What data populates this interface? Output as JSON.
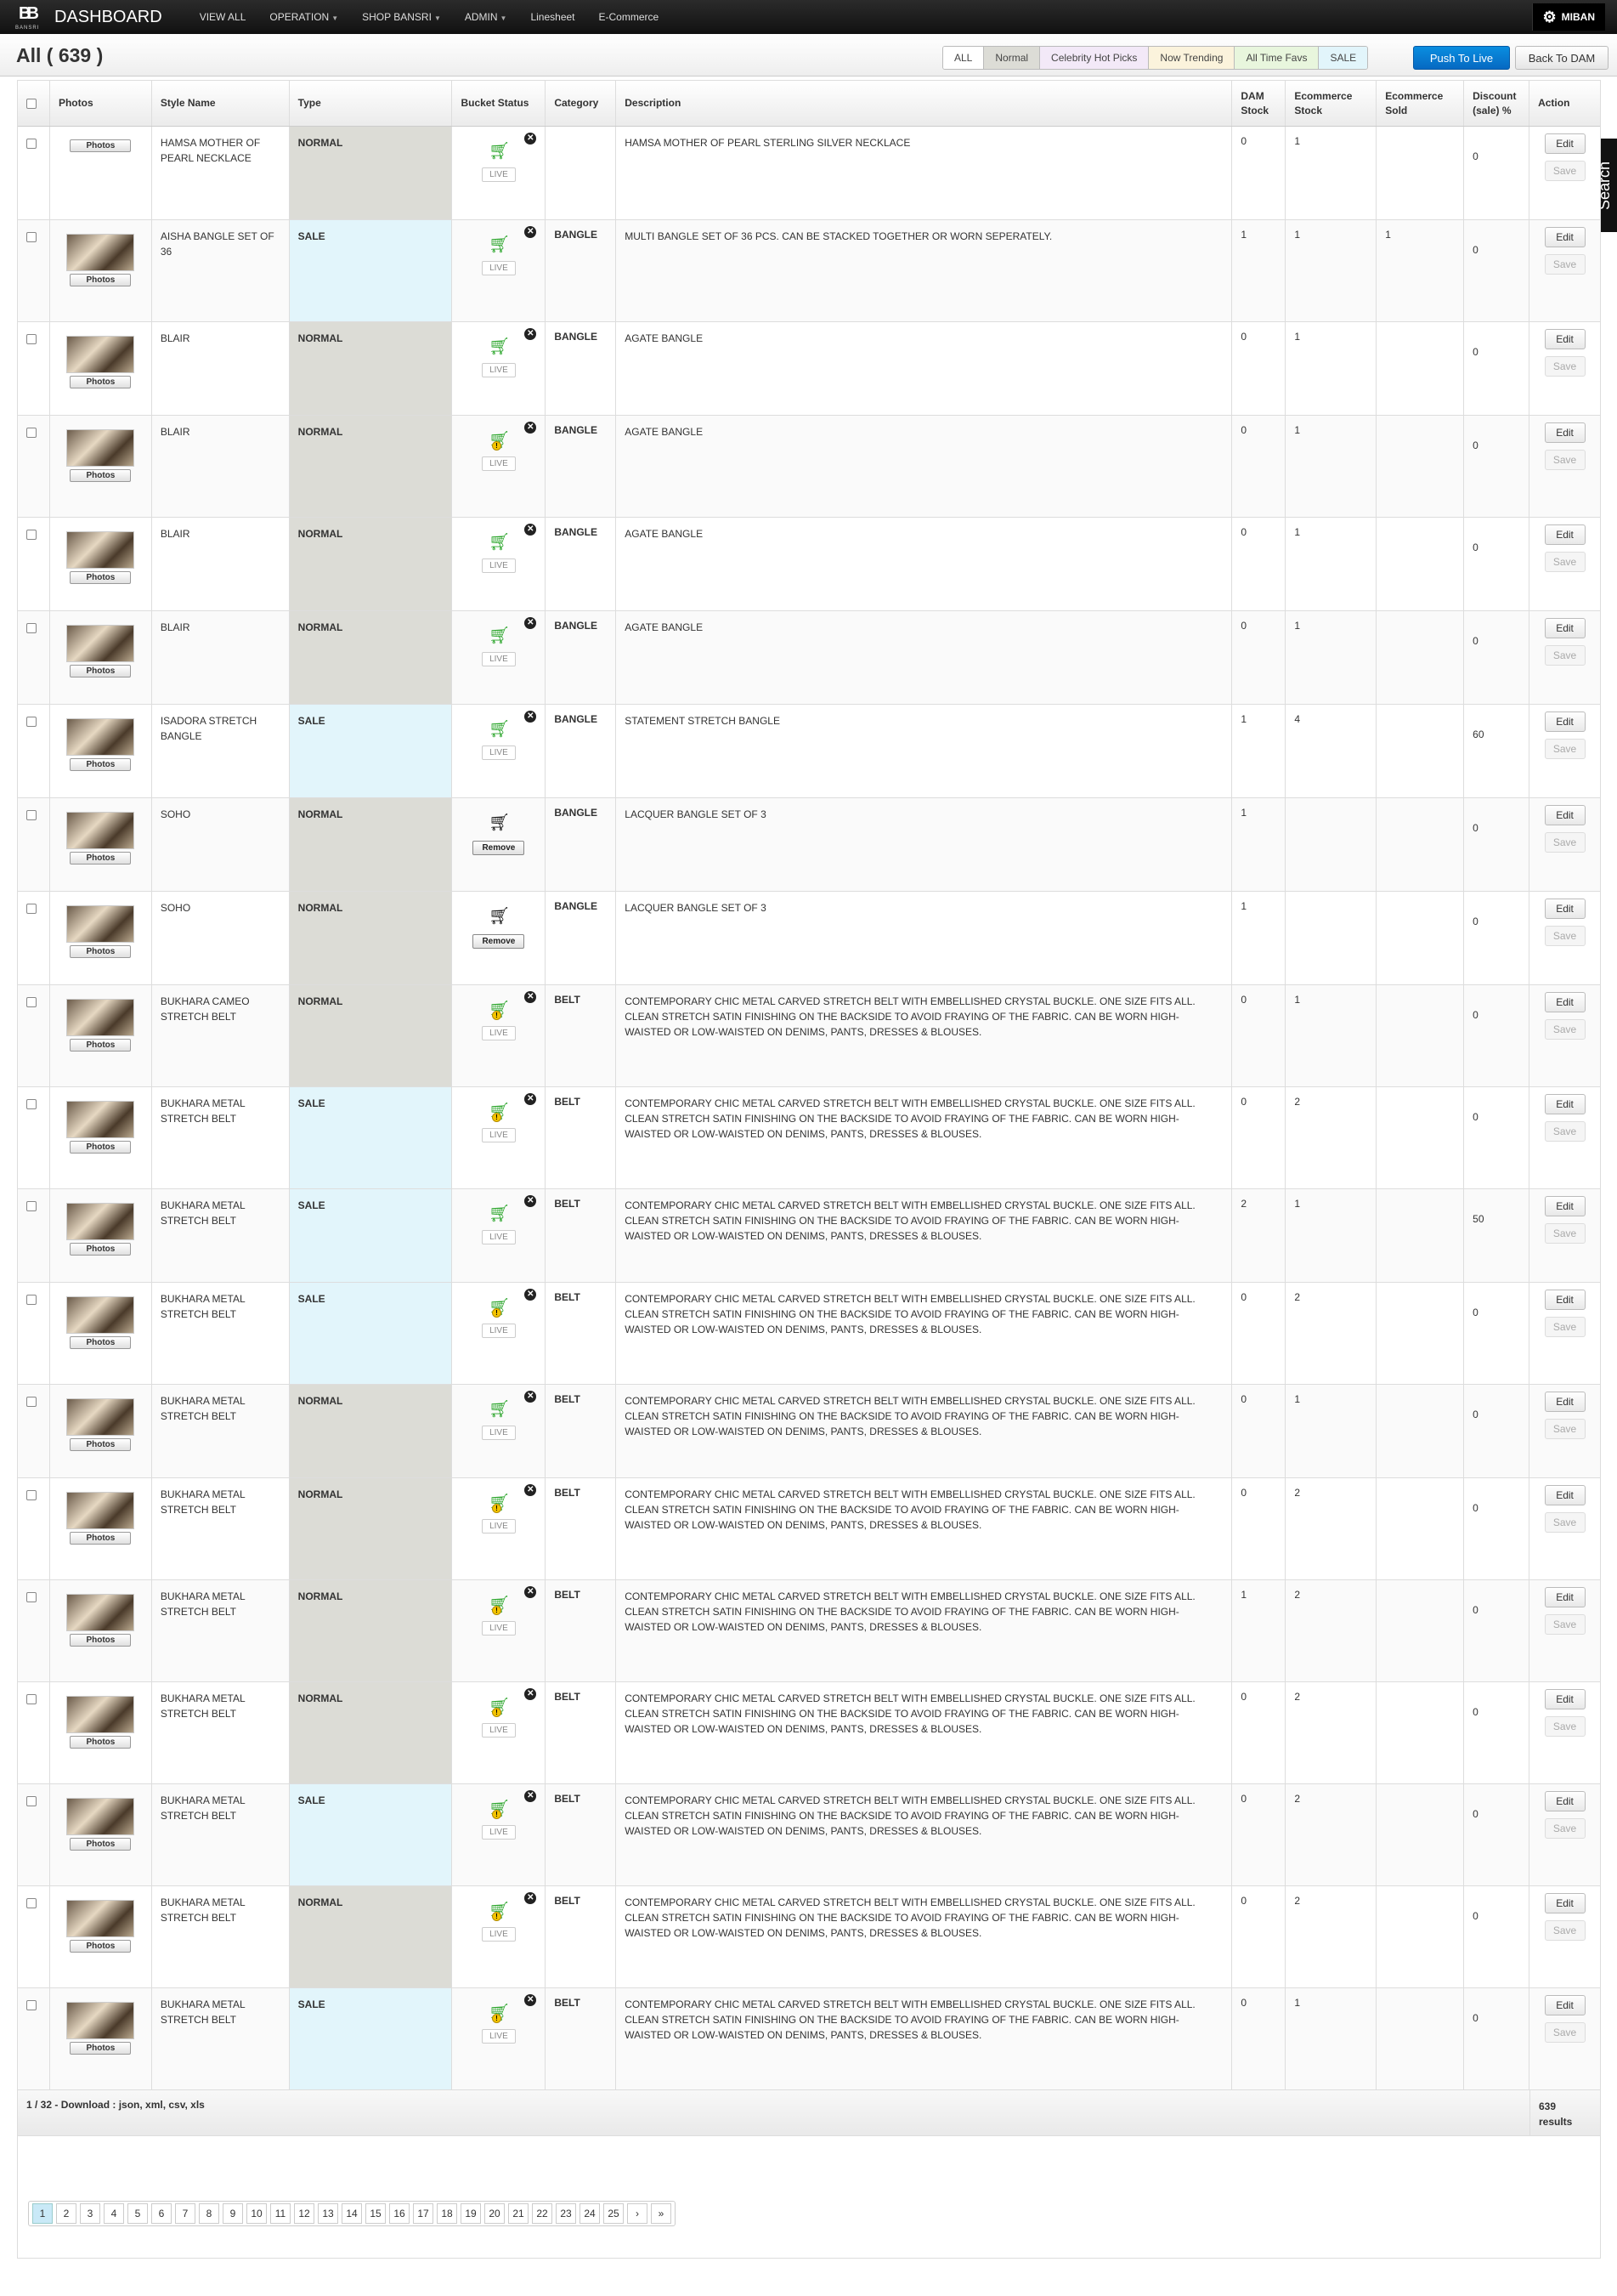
{
  "topbar": {
    "brand": "DASHBOARD",
    "logo_letters": "BB",
    "logo_sub": "BANSRI",
    "nav": [
      {
        "label": "VIEW ALL",
        "caret": false
      },
      {
        "label": "OPERATION",
        "caret": true
      },
      {
        "label": "SHOP BANSRI",
        "caret": true
      },
      {
        "label": "ADMIN",
        "caret": true
      },
      {
        "label": "Linesheet",
        "caret": false
      },
      {
        "label": "E-Commerce",
        "caret": false
      }
    ],
    "user": "MIBAN"
  },
  "page_title": "All ( 639 )",
  "filters": [
    {
      "label": "ALL",
      "color": "#ffffff"
    },
    {
      "label": "Normal",
      "color": "#dcdcd6"
    },
    {
      "label": "Celebrity Hot Picks",
      "color": "#f3e9f8"
    },
    {
      "label": "Now Trending",
      "color": "#fbf3dc"
    },
    {
      "label": "All Time Favs",
      "color": "#e8f6dd"
    },
    {
      "label": "SALE",
      "color": "#e2f5fb"
    }
  ],
  "buttons": {
    "push": "Push To Live",
    "back": "Back To DAM",
    "search": "Search"
  },
  "columns": [
    "",
    "Photos",
    "Style Name",
    "Type",
    "Bucket Status",
    "Category",
    "Description",
    "DAM Stock",
    "Ecommerce Stock",
    "Ecommerce Sold",
    "Discount (sale) %",
    "Action"
  ],
  "labels": {
    "photos": "Photos",
    "live": "LIVE",
    "remove": "Remove",
    "edit": "Edit",
    "save": "Save"
  },
  "rows": [
    {
      "style": "HAMSA MOTHER OF PEARL NECKLACE",
      "type": "NORMAL",
      "bucket": "live",
      "category": "",
      "desc": "HAMSA MOTHER OF PEARL STERLING SILVER NECKLACE",
      "dam": "0",
      "ecom": "1",
      "sold": "",
      "disc": "0",
      "thumb": false,
      "h": 110
    },
    {
      "style": "AISHA BANGLE SET OF 36",
      "type": "SALE",
      "bucket": "live",
      "category": "BANGLE",
      "desc": "MULTI BANGLE SET OF 36 PCS. CAN BE STACKED TOGETHER OR WORN SEPERATELY.",
      "dam": "1",
      "ecom": "1",
      "sold": "1",
      "disc": "0",
      "thumb": true,
      "h": 120
    },
    {
      "style": "BLAIR",
      "type": "NORMAL",
      "bucket": "live",
      "category": "BANGLE",
      "desc": "AGATE BANGLE",
      "dam": "0",
      "ecom": "1",
      "sold": "",
      "disc": "0",
      "thumb": true,
      "h": 110
    },
    {
      "style": "BLAIR",
      "type": "NORMAL",
      "bucket": "live-warn",
      "category": "BANGLE",
      "desc": "AGATE BANGLE",
      "dam": "0",
      "ecom": "1",
      "sold": "",
      "disc": "0",
      "thumb": true,
      "h": 120
    },
    {
      "style": "BLAIR",
      "type": "NORMAL",
      "bucket": "live",
      "category": "BANGLE",
      "desc": "AGATE BANGLE",
      "dam": "0",
      "ecom": "1",
      "sold": "",
      "disc": "0",
      "thumb": true,
      "h": 110
    },
    {
      "style": "BLAIR",
      "type": "NORMAL",
      "bucket": "live",
      "category": "BANGLE",
      "desc": "AGATE BANGLE",
      "dam": "0",
      "ecom": "1",
      "sold": "",
      "disc": "0",
      "thumb": true,
      "h": 110
    },
    {
      "style": "ISADORA STRETCH BANGLE",
      "type": "SALE",
      "bucket": "live",
      "category": "BANGLE",
      "desc": "STATEMENT STRETCH BANGLE",
      "dam": "1",
      "ecom": "4",
      "sold": "",
      "disc": "60",
      "thumb": true,
      "h": 110
    },
    {
      "style": "SOHO",
      "type": "NORMAL",
      "bucket": "remove",
      "category": "BANGLE",
      "desc": "LACQUER BANGLE SET OF 3",
      "dam": "1",
      "ecom": "",
      "sold": "",
      "disc": "0",
      "thumb": true,
      "h": 110
    },
    {
      "style": "SOHO",
      "type": "NORMAL",
      "bucket": "remove",
      "category": "BANGLE",
      "desc": "LACQUER BANGLE SET OF 3",
      "dam": "1",
      "ecom": "",
      "sold": "",
      "disc": "0",
      "thumb": true,
      "h": 110
    },
    {
      "style": "BUKHARA CAMEO STRETCH BELT",
      "type": "NORMAL",
      "bucket": "live-warn",
      "category": "BELT",
      "desc": "CONTEMPORARY CHIC METAL CARVED STRETCH BELT WITH EMBELLISHED CRYSTAL BUCKLE. ONE SIZE FITS ALL. CLEAN STRETCH SATIN FINISHING ON THE BACKSIDE TO AVOID FRAYING OF THE FABRIC. CAN BE WORN HIGH-WAISTED OR LOW-WAISTED ON DENIMS, PANTS, DRESSES & BLOUSES.",
      "dam": "0",
      "ecom": "1",
      "sold": "",
      "disc": "0",
      "thumb": true,
      "h": 120
    },
    {
      "style": "BUKHARA METAL STRETCH BELT",
      "type": "SALE",
      "bucket": "live-warn",
      "category": "BELT",
      "desc": "CONTEMPORARY CHIC METAL CARVED STRETCH BELT WITH EMBELLISHED CRYSTAL BUCKLE. ONE SIZE FITS ALL. CLEAN STRETCH SATIN FINISHING ON THE BACKSIDE TO AVOID FRAYING OF THE FABRIC. CAN BE WORN HIGH-WAISTED OR LOW-WAISTED ON DENIMS, PANTS, DRESSES & BLOUSES.",
      "dam": "0",
      "ecom": "2",
      "sold": "",
      "disc": "0",
      "thumb": true,
      "h": 120
    },
    {
      "style": "BUKHARA METAL STRETCH BELT",
      "type": "SALE",
      "bucket": "live",
      "category": "BELT",
      "desc": "CONTEMPORARY CHIC METAL CARVED STRETCH BELT WITH EMBELLISHED CRYSTAL BUCKLE. ONE SIZE FITS ALL. CLEAN STRETCH SATIN FINISHING ON THE BACKSIDE TO AVOID FRAYING OF THE FABRIC. CAN BE WORN HIGH-WAISTED OR LOW-WAISTED ON DENIMS, PANTS, DRESSES & BLOUSES.",
      "dam": "2",
      "ecom": "1",
      "sold": "",
      "disc": "50",
      "thumb": true,
      "h": 110
    },
    {
      "style": "BUKHARA METAL STRETCH BELT",
      "type": "SALE",
      "bucket": "live-warn",
      "category": "BELT",
      "desc": "CONTEMPORARY CHIC METAL CARVED STRETCH BELT WITH EMBELLISHED CRYSTAL BUCKLE. ONE SIZE FITS ALL. CLEAN STRETCH SATIN FINISHING ON THE BACKSIDE TO AVOID FRAYING OF THE FABRIC. CAN BE WORN HIGH-WAISTED OR LOW-WAISTED ON DENIMS, PANTS, DRESSES & BLOUSES.",
      "dam": "0",
      "ecom": "2",
      "sold": "",
      "disc": "0",
      "thumb": true,
      "h": 120
    },
    {
      "style": "BUKHARA METAL STRETCH BELT",
      "type": "NORMAL",
      "bucket": "live",
      "category": "BELT",
      "desc": "CONTEMPORARY CHIC METAL CARVED STRETCH BELT WITH EMBELLISHED CRYSTAL BUCKLE. ONE SIZE FITS ALL. CLEAN STRETCH SATIN FINISHING ON THE BACKSIDE TO AVOID FRAYING OF THE FABRIC. CAN BE WORN HIGH-WAISTED OR LOW-WAISTED ON DENIMS, PANTS, DRESSES & BLOUSES.",
      "dam": "0",
      "ecom": "1",
      "sold": "",
      "disc": "0",
      "thumb": true,
      "h": 110
    },
    {
      "style": "BUKHARA METAL STRETCH BELT",
      "type": "NORMAL",
      "bucket": "live-warn",
      "category": "BELT",
      "desc": "CONTEMPORARY CHIC METAL CARVED STRETCH BELT WITH EMBELLISHED CRYSTAL BUCKLE. ONE SIZE FITS ALL. CLEAN STRETCH SATIN FINISHING ON THE BACKSIDE TO AVOID FRAYING OF THE FABRIC. CAN BE WORN HIGH-WAISTED OR LOW-WAISTED ON DENIMS, PANTS, DRESSES & BLOUSES.",
      "dam": "0",
      "ecom": "2",
      "sold": "",
      "disc": "0",
      "thumb": true,
      "h": 120
    },
    {
      "style": "BUKHARA METAL STRETCH BELT",
      "type": "NORMAL",
      "bucket": "live-warn",
      "category": "BELT",
      "desc": "CONTEMPORARY CHIC METAL CARVED STRETCH BELT WITH EMBELLISHED CRYSTAL BUCKLE. ONE SIZE FITS ALL. CLEAN STRETCH SATIN FINISHING ON THE BACKSIDE TO AVOID FRAYING OF THE FABRIC. CAN BE WORN HIGH-WAISTED OR LOW-WAISTED ON DENIMS, PANTS, DRESSES & BLOUSES.",
      "dam": "1",
      "ecom": "2",
      "sold": "",
      "disc": "0",
      "thumb": true,
      "h": 120
    },
    {
      "style": "BUKHARA METAL STRETCH BELT",
      "type": "NORMAL",
      "bucket": "live-warn",
      "category": "BELT",
      "desc": "CONTEMPORARY CHIC METAL CARVED STRETCH BELT WITH EMBELLISHED CRYSTAL BUCKLE. ONE SIZE FITS ALL. CLEAN STRETCH SATIN FINISHING ON THE BACKSIDE TO AVOID FRAYING OF THE FABRIC. CAN BE WORN HIGH-WAISTED OR LOW-WAISTED ON DENIMS, PANTS, DRESSES & BLOUSES.",
      "dam": "0",
      "ecom": "2",
      "sold": "",
      "disc": "0",
      "thumb": true,
      "h": 120
    },
    {
      "style": "BUKHARA METAL STRETCH BELT",
      "type": "SALE",
      "bucket": "live-warn",
      "category": "BELT",
      "desc": "CONTEMPORARY CHIC METAL CARVED STRETCH BELT WITH EMBELLISHED CRYSTAL BUCKLE. ONE SIZE FITS ALL. CLEAN STRETCH SATIN FINISHING ON THE BACKSIDE TO AVOID FRAYING OF THE FABRIC. CAN BE WORN HIGH-WAISTED OR LOW-WAISTED ON DENIMS, PANTS, DRESSES & BLOUSES.",
      "dam": "0",
      "ecom": "2",
      "sold": "",
      "disc": "0",
      "thumb": true,
      "h": 120
    },
    {
      "style": "BUKHARA METAL STRETCH BELT",
      "type": "NORMAL",
      "bucket": "live-warn",
      "category": "BELT",
      "desc": "CONTEMPORARY CHIC METAL CARVED STRETCH BELT WITH EMBELLISHED CRYSTAL BUCKLE. ONE SIZE FITS ALL. CLEAN STRETCH SATIN FINISHING ON THE BACKSIDE TO AVOID FRAYING OF THE FABRIC. CAN BE WORN HIGH-WAISTED OR LOW-WAISTED ON DENIMS, PANTS, DRESSES & BLOUSES.",
      "dam": "0",
      "ecom": "2",
      "sold": "",
      "disc": "0",
      "thumb": true,
      "h": 120
    },
    {
      "style": "BUKHARA METAL STRETCH BELT",
      "type": "SALE",
      "bucket": "live-warn",
      "category": "BELT",
      "desc": "CONTEMPORARY CHIC METAL CARVED STRETCH BELT WITH EMBELLISHED CRYSTAL BUCKLE. ONE SIZE FITS ALL. CLEAN STRETCH SATIN FINISHING ON THE BACKSIDE TO AVOID FRAYING OF THE FABRIC. CAN BE WORN HIGH-WAISTED OR LOW-WAISTED ON DENIMS, PANTS, DRESSES & BLOUSES.",
      "dam": "0",
      "ecom": "1",
      "sold": "",
      "disc": "0",
      "thumb": true,
      "h": 120
    }
  ],
  "footer": {
    "left_page": "1 / 32",
    "left_text": " - Download : ",
    "formats": "json, xml, csv, xls",
    "results": "639 results"
  },
  "pager": [
    "1",
    "2",
    "3",
    "4",
    "5",
    "6",
    "7",
    "8",
    "9",
    "10",
    "11",
    "12",
    "13",
    "14",
    "15",
    "16",
    "17",
    "18",
    "19",
    "20",
    "21",
    "22",
    "23",
    "24",
    "25",
    "›",
    "»"
  ]
}
